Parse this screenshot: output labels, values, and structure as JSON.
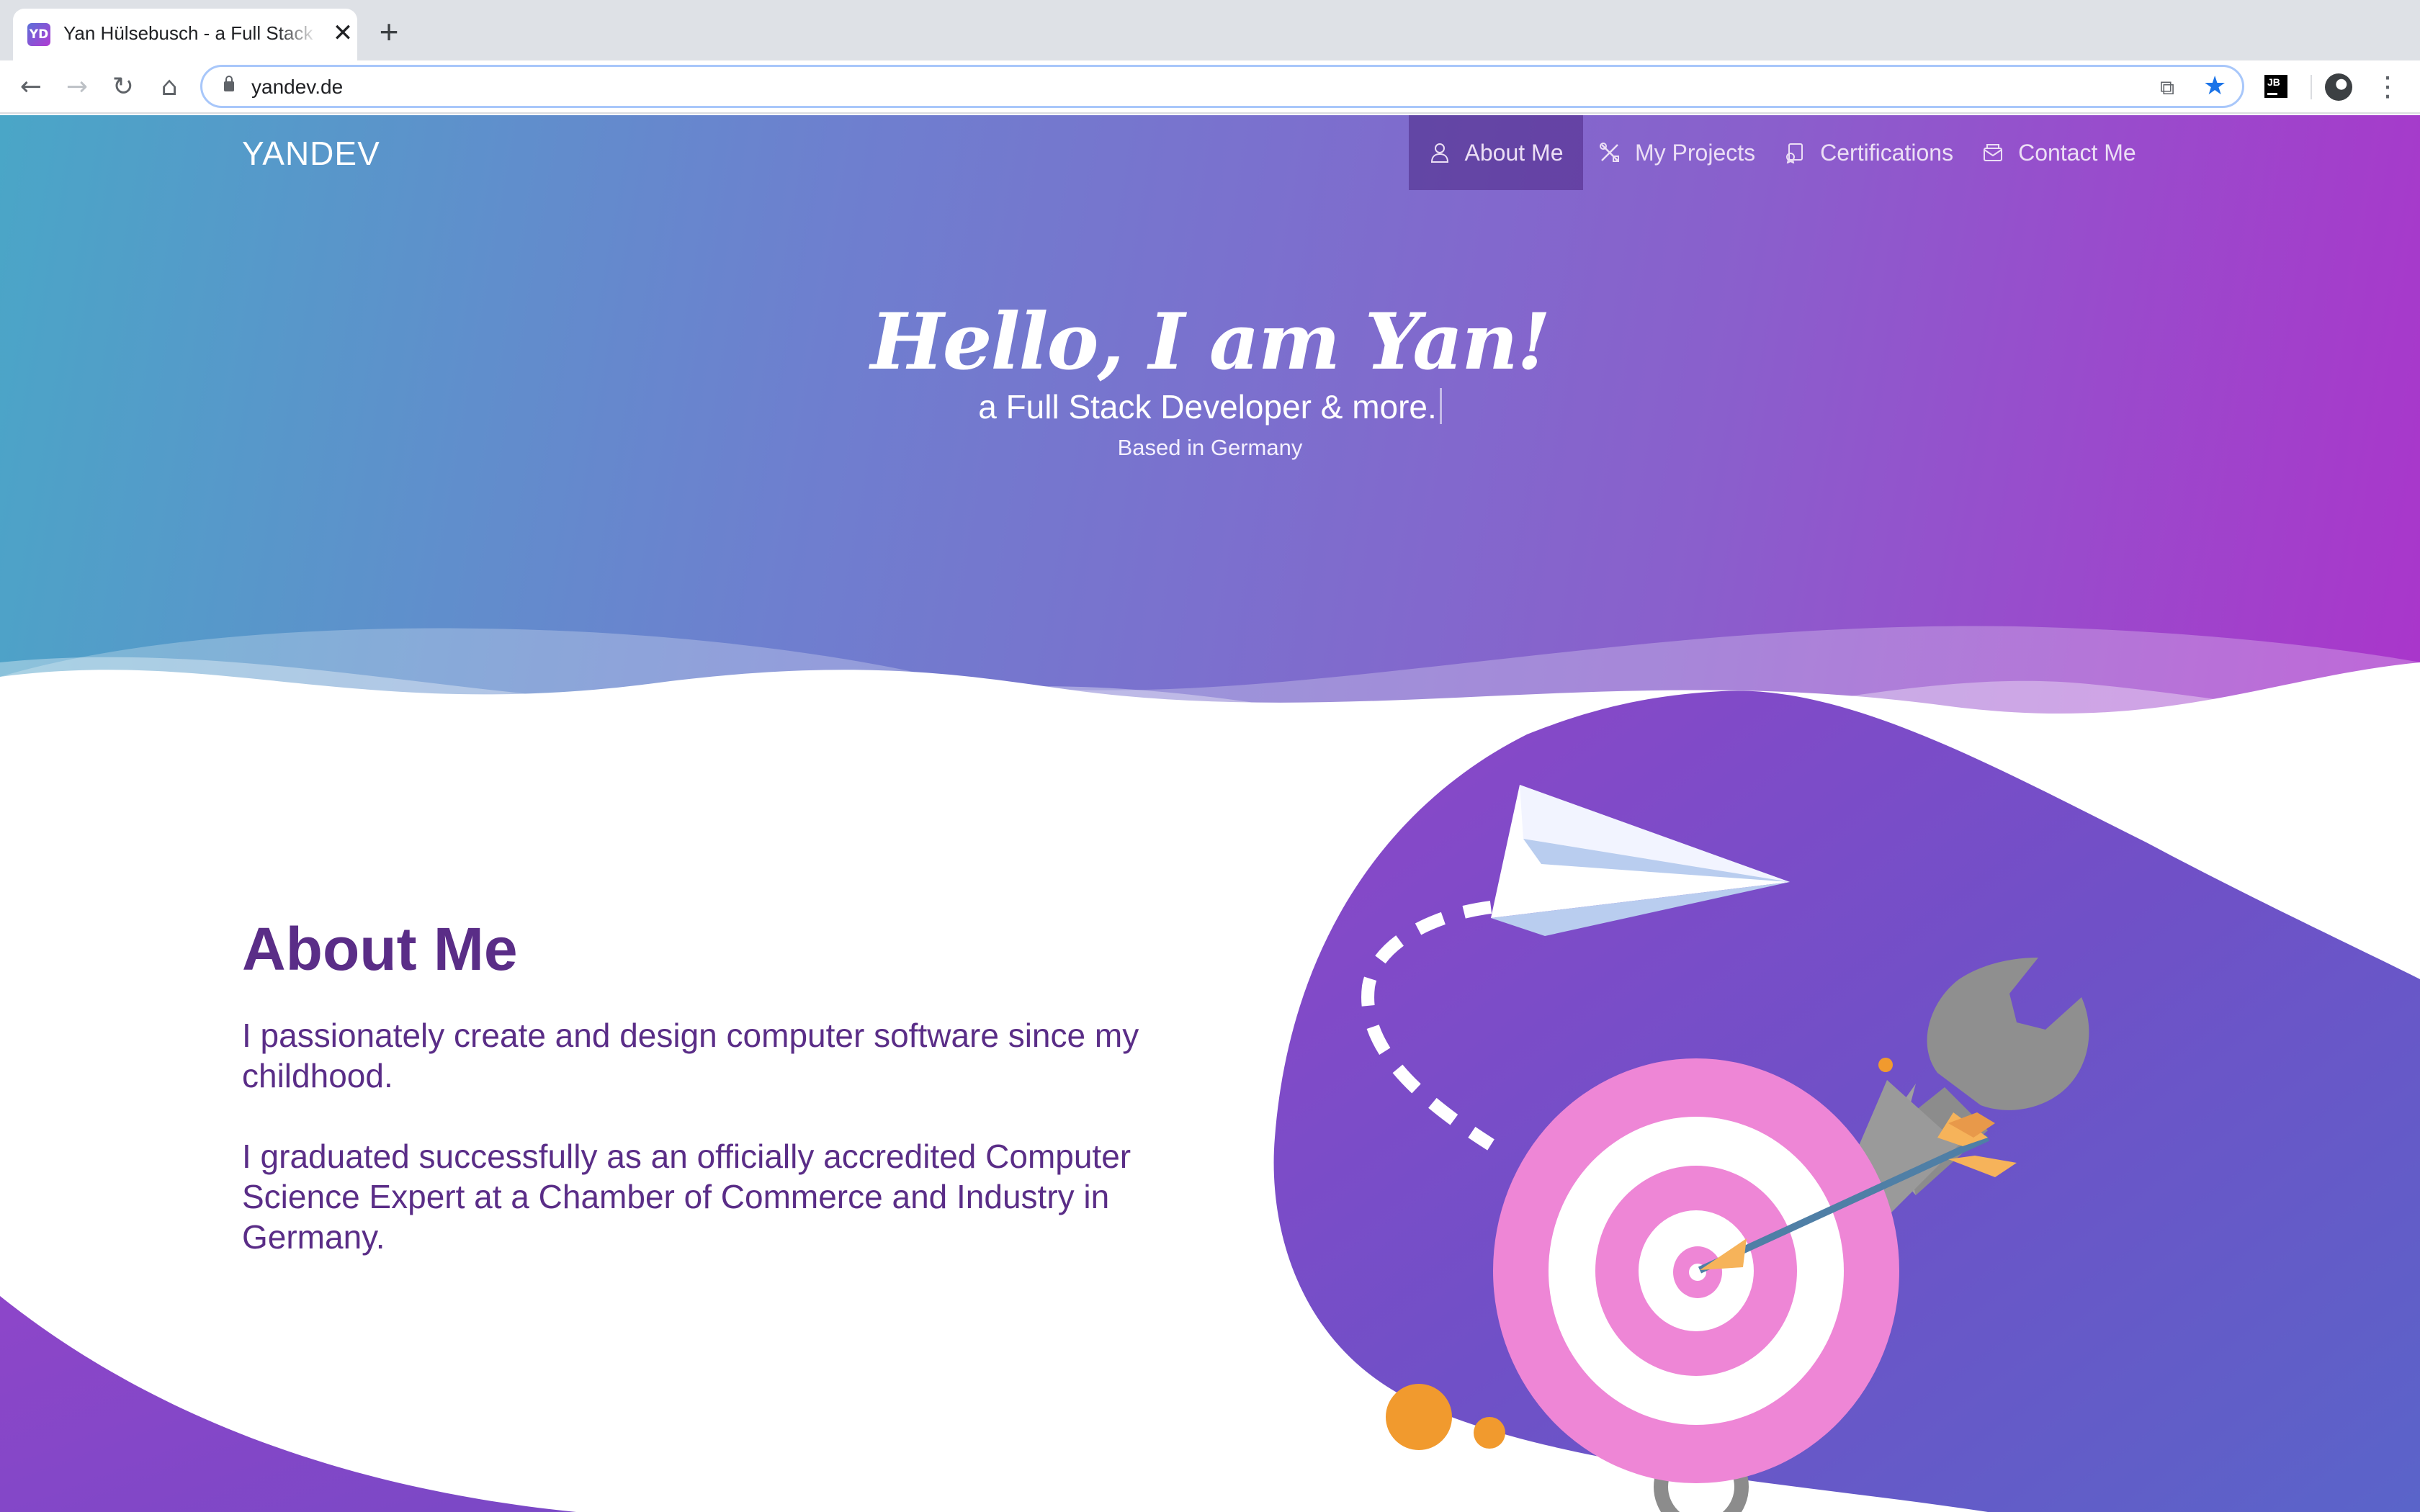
{
  "browser": {
    "tab_title": "Yan Hülsebusch - a Full Stack Developer",
    "favicon_text": "YD",
    "tab_close": "✕",
    "new_tab": "+",
    "url": "yandev.de",
    "back": "←",
    "forward": "→",
    "reload": "↻",
    "home": "⌂",
    "cast": "⧉",
    "bookmark": "★",
    "extension_label": "JB",
    "menu": "⋮"
  },
  "site": {
    "brand": "YANDEV",
    "nav": [
      {
        "label": "About Me",
        "icon": "user-icon",
        "active": true
      },
      {
        "label": "My Projects",
        "icon": "tools-icon",
        "active": false
      },
      {
        "label": "Certifications",
        "icon": "certificate-icon",
        "active": false
      },
      {
        "label": "Contact Me",
        "icon": "envelope-icon",
        "active": false
      }
    ]
  },
  "hero": {
    "title": "Hello, I am Yan!",
    "subtitle": "a Full Stack Developer & more.",
    "location": "Based in Germany"
  },
  "about": {
    "title": "About Me",
    "paragraphs": [
      "I passionately create and design computer software since my childhood.",
      "I graduated successfully as an officially accredited Computer Science Expert at a Chamber of Commerce and Industry in Germany."
    ]
  },
  "colors": {
    "hero_gradient": [
      "#4aa6c7",
      "#6e7fcf",
      "#8a5fcc",
      "#aa35cb"
    ],
    "text_purple": "#5a2d87",
    "target_pink": "#ee86d6",
    "accent_orange": "#f19a2e"
  }
}
